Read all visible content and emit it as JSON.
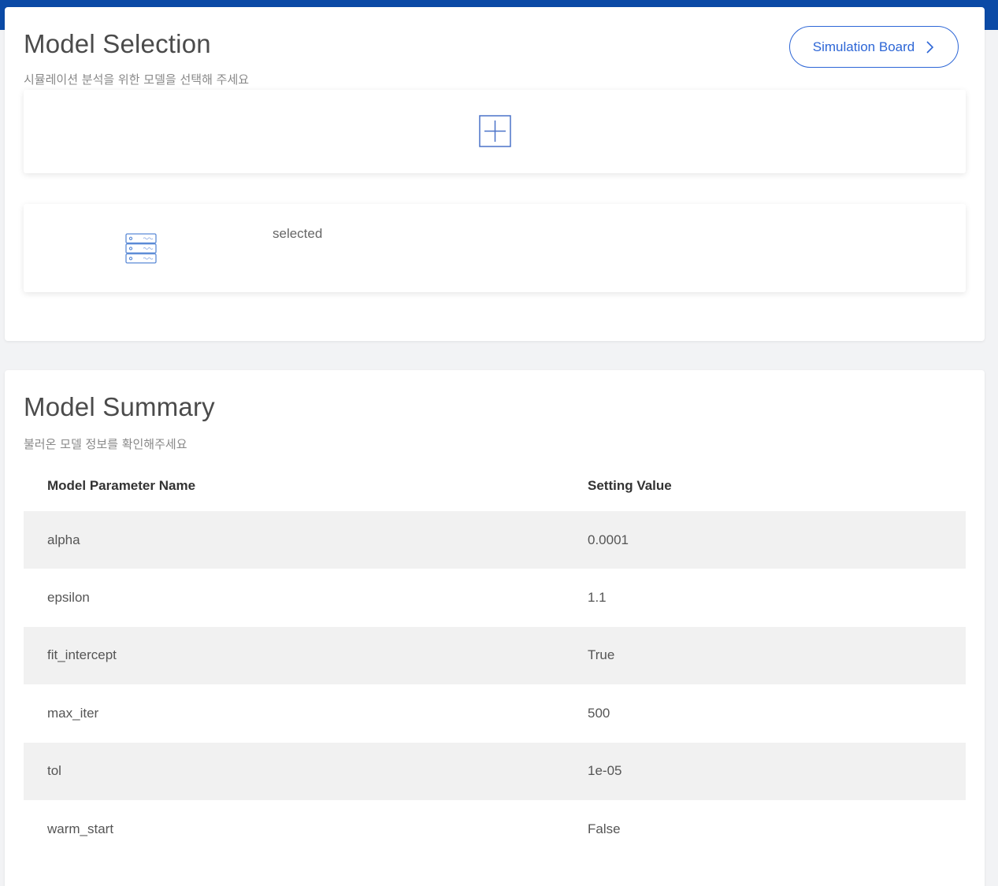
{
  "selection": {
    "title": "Model Selection",
    "subtitle": "시뮬레이션 분석을 위한 모델을 선택해 주세요",
    "sim_button_label": "Simulation Board",
    "model_status": "selected"
  },
  "summary": {
    "title": "Model Summary",
    "subtitle": "불러온 모델 정보를 확인해주세요",
    "columns": [
      "Model Parameter Name",
      "Setting Value"
    ],
    "rows": [
      {
        "name": "alpha",
        "value": "0.0001"
      },
      {
        "name": "epsilon",
        "value": "1.1"
      },
      {
        "name": "fit_intercept",
        "value": "True"
      },
      {
        "name": "max_iter",
        "value": "500"
      },
      {
        "name": "tol",
        "value": "1e-05"
      },
      {
        "name": "warm_start",
        "value": "False"
      }
    ]
  },
  "icons": {
    "add": "plus-square-icon",
    "model": "server-stack-icon",
    "chevron": "chevron-right-icon"
  },
  "colors": {
    "header_bar": "#0b4aa6",
    "accent": "#2d66d6",
    "stripe": "#f1f1f1"
  }
}
